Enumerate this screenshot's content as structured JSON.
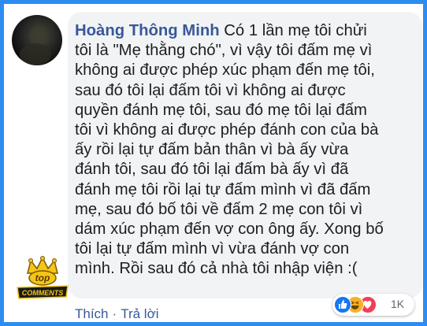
{
  "comment": {
    "author": "Hoàng Thông Minh",
    "lines": [
      "Có 1 lần mẹ tôi chửi",
      "tôi là \"Mẹ thằng chó\", vì vậy tôi đấm mẹ vì",
      "không ai được phép xúc phạm đến mẹ tôi,",
      "sau đó tôi lại đấm tôi vì không ai được",
      "quyền đánh mẹ tôi, sau đó mẹ tôi lại đấm",
      "tôi vì không ai được phép đánh con của bà",
      "ấy rồi lại tự đấm bản thân vì bà ấy vừa",
      "đánh tôi, sau đó tôi lại đấm bà ấy vì đã",
      "đánh mẹ tôi rồi lại tự đấm mình vì đã đấm",
      "mẹ, sau đó bố tôi về đấm 2 mẹ con tôi vì",
      "dám xúc phạm đến vợ con ông ấy. Xong bố",
      "tôi lại tự đấm mình vì vừa đánh vợ con",
      "mình. Rồi sau đó cả nhà tôi nhập viện :("
    ]
  },
  "actions": {
    "like_label": "Thích",
    "separator": "·",
    "reply_label": "Trả lời"
  },
  "reactions": {
    "icons": [
      "like-icon",
      "haha-icon",
      "love-icon"
    ],
    "count": "1K"
  },
  "badge": {
    "line1": "top",
    "line2": "COMMENTS"
  },
  "colors": {
    "frame": "#2d8cf0",
    "author": "#385898",
    "bubble": "#f2f3f5",
    "text": "#1c1e21"
  }
}
